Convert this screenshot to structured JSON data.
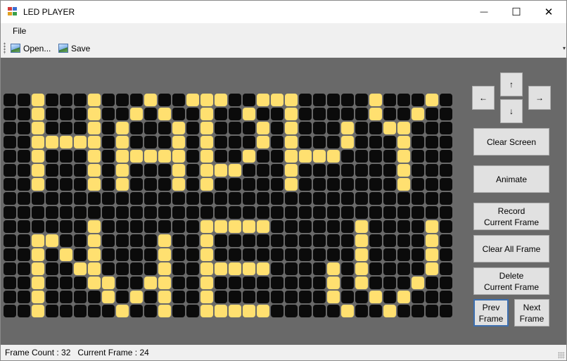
{
  "window": {
    "title": "LED PLAYER",
    "minimize_glyph": "—",
    "maximize_glyph": "☐",
    "close_glyph": "✕"
  },
  "menu": {
    "file": "File"
  },
  "toolbar": {
    "open_label": "Open...",
    "save_label": "Save",
    "open_icon": "image-icon",
    "save_icon": "image-icon"
  },
  "controls": {
    "up": "↑",
    "left": "←",
    "right": "→",
    "down": "↓",
    "clear_screen": "Clear Screen",
    "animate": "Animate",
    "record_line1": "Record",
    "record_line2": "Current Frame",
    "clear_all_frame": "Clear All Frame",
    "delete_line1": "Delete",
    "delete_line2": "Current Frame",
    "prev_line1": "Prev",
    "prev_line2": "Frame",
    "next_line1": "Next",
    "next_line2": "Frame"
  },
  "status": {
    "frame_count_label": "Frame Count :",
    "frame_count": "32",
    "current_frame_label": "Current Frame :",
    "current_frame": "24"
  },
  "colors": {
    "led_on": "#ffe070",
    "led_off": "#0b0b0b",
    "background": "#696969"
  },
  "led_matrix": [
    "00100010001001110011100000100010",
    "00100010010100100100100000100100",
    "00100010100010100010100010011000",
    "00111110100010100010100010001000",
    "00100010111110100100111100001000",
    "00100010100010111000100000001000",
    "00100010100010100000100000001000",
    "00000000000000000000000000000000",
    "00000000000000000000000000000000",
    "00000010000000111110000001000010",
    "00110010000100100000000001000010",
    "00101010000100100000000001000010",
    "00100110000100111110000101000010",
    "00100011001100100000000101000100",
    "00100001010100100000000100101000",
    "00100000100100111110000010010000"
  ]
}
